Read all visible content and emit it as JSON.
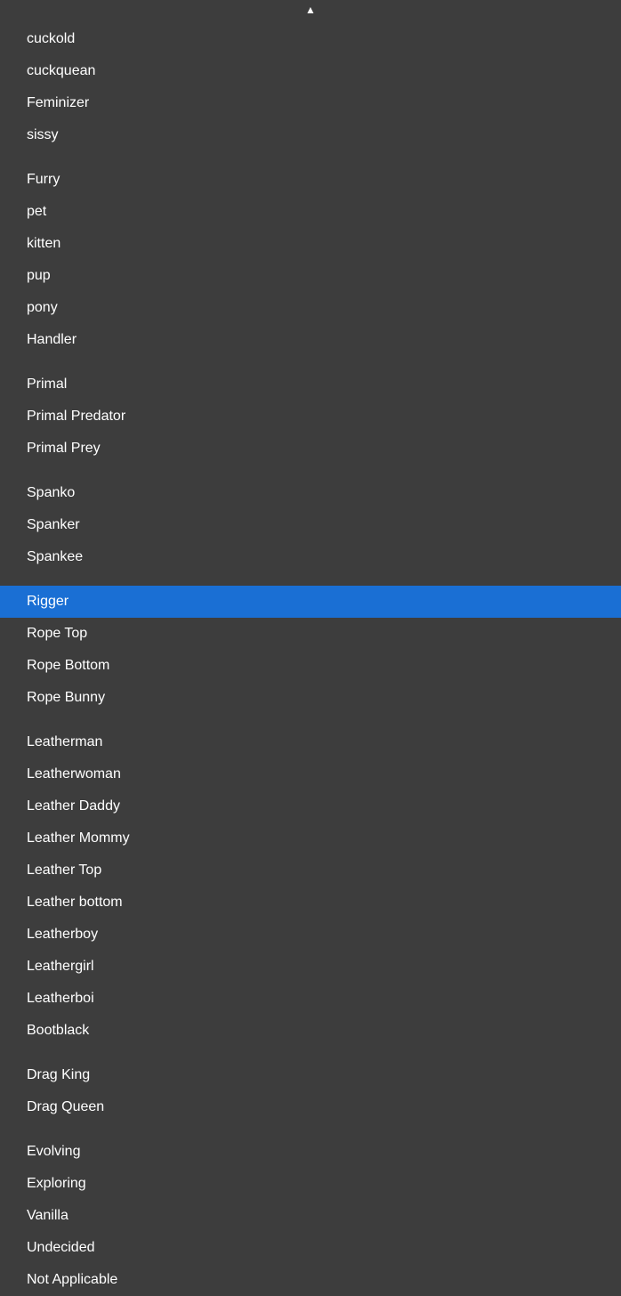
{
  "scroll_up_indicator": "▲",
  "items": [
    {
      "id": "cuckold",
      "label": "cuckold",
      "group": 1,
      "selected": false
    },
    {
      "id": "cuckquean",
      "label": "cuckquean",
      "group": 1,
      "selected": false
    },
    {
      "id": "feminizer",
      "label": "Feminizer",
      "group": 1,
      "selected": false
    },
    {
      "id": "sissy",
      "label": "sissy",
      "group": 1,
      "selected": false
    },
    {
      "id": "furry",
      "label": "Furry",
      "group": 2,
      "selected": false
    },
    {
      "id": "pet",
      "label": "pet",
      "group": 2,
      "selected": false
    },
    {
      "id": "kitten",
      "label": "kitten",
      "group": 2,
      "selected": false
    },
    {
      "id": "pup",
      "label": "pup",
      "group": 2,
      "selected": false
    },
    {
      "id": "pony",
      "label": "pony",
      "group": 2,
      "selected": false
    },
    {
      "id": "handler",
      "label": "Handler",
      "group": 2,
      "selected": false
    },
    {
      "id": "primal",
      "label": "Primal",
      "group": 3,
      "selected": false
    },
    {
      "id": "primal-predator",
      "label": "Primal Predator",
      "group": 3,
      "selected": false
    },
    {
      "id": "primal-prey",
      "label": "Primal Prey",
      "group": 3,
      "selected": false
    },
    {
      "id": "spanko",
      "label": "Spanko",
      "group": 4,
      "selected": false
    },
    {
      "id": "spanker",
      "label": "Spanker",
      "group": 4,
      "selected": false
    },
    {
      "id": "spankee",
      "label": "Spankee",
      "group": 4,
      "selected": false
    },
    {
      "id": "rigger",
      "label": "Rigger",
      "group": 5,
      "selected": true
    },
    {
      "id": "rope-top",
      "label": "Rope Top",
      "group": 5,
      "selected": false
    },
    {
      "id": "rope-bottom",
      "label": "Rope Bottom",
      "group": 5,
      "selected": false
    },
    {
      "id": "rope-bunny",
      "label": "Rope Bunny",
      "group": 5,
      "selected": false
    },
    {
      "id": "leatherman",
      "label": "Leatherman",
      "group": 6,
      "selected": false
    },
    {
      "id": "leatherwoman",
      "label": "Leatherwoman",
      "group": 6,
      "selected": false
    },
    {
      "id": "leather-daddy",
      "label": "Leather Daddy",
      "group": 6,
      "selected": false
    },
    {
      "id": "leather-mommy",
      "label": "Leather Mommy",
      "group": 6,
      "selected": false
    },
    {
      "id": "leather-top",
      "label": "Leather Top",
      "group": 6,
      "selected": false
    },
    {
      "id": "leather-bottom",
      "label": "Leather bottom",
      "group": 6,
      "selected": false
    },
    {
      "id": "leatherboy",
      "label": "Leatherboy",
      "group": 6,
      "selected": false
    },
    {
      "id": "leathergirl",
      "label": "Leathergirl",
      "group": 6,
      "selected": false
    },
    {
      "id": "leatherboi",
      "label": "Leatherboi",
      "group": 6,
      "selected": false
    },
    {
      "id": "bootblack",
      "label": "Bootblack",
      "group": 6,
      "selected": false
    },
    {
      "id": "drag-king",
      "label": "Drag King",
      "group": 7,
      "selected": false
    },
    {
      "id": "drag-queen",
      "label": "Drag Queen",
      "group": 7,
      "selected": false
    },
    {
      "id": "evolving",
      "label": "Evolving",
      "group": 8,
      "selected": false
    },
    {
      "id": "exploring",
      "label": "Exploring",
      "group": 8,
      "selected": false
    },
    {
      "id": "vanilla",
      "label": "Vanilla",
      "group": 8,
      "selected": false
    },
    {
      "id": "undecided",
      "label": "Undecided",
      "group": 8,
      "selected": false
    },
    {
      "id": "not-applicable",
      "label": "Not Applicable",
      "group": 8,
      "selected": false
    }
  ]
}
